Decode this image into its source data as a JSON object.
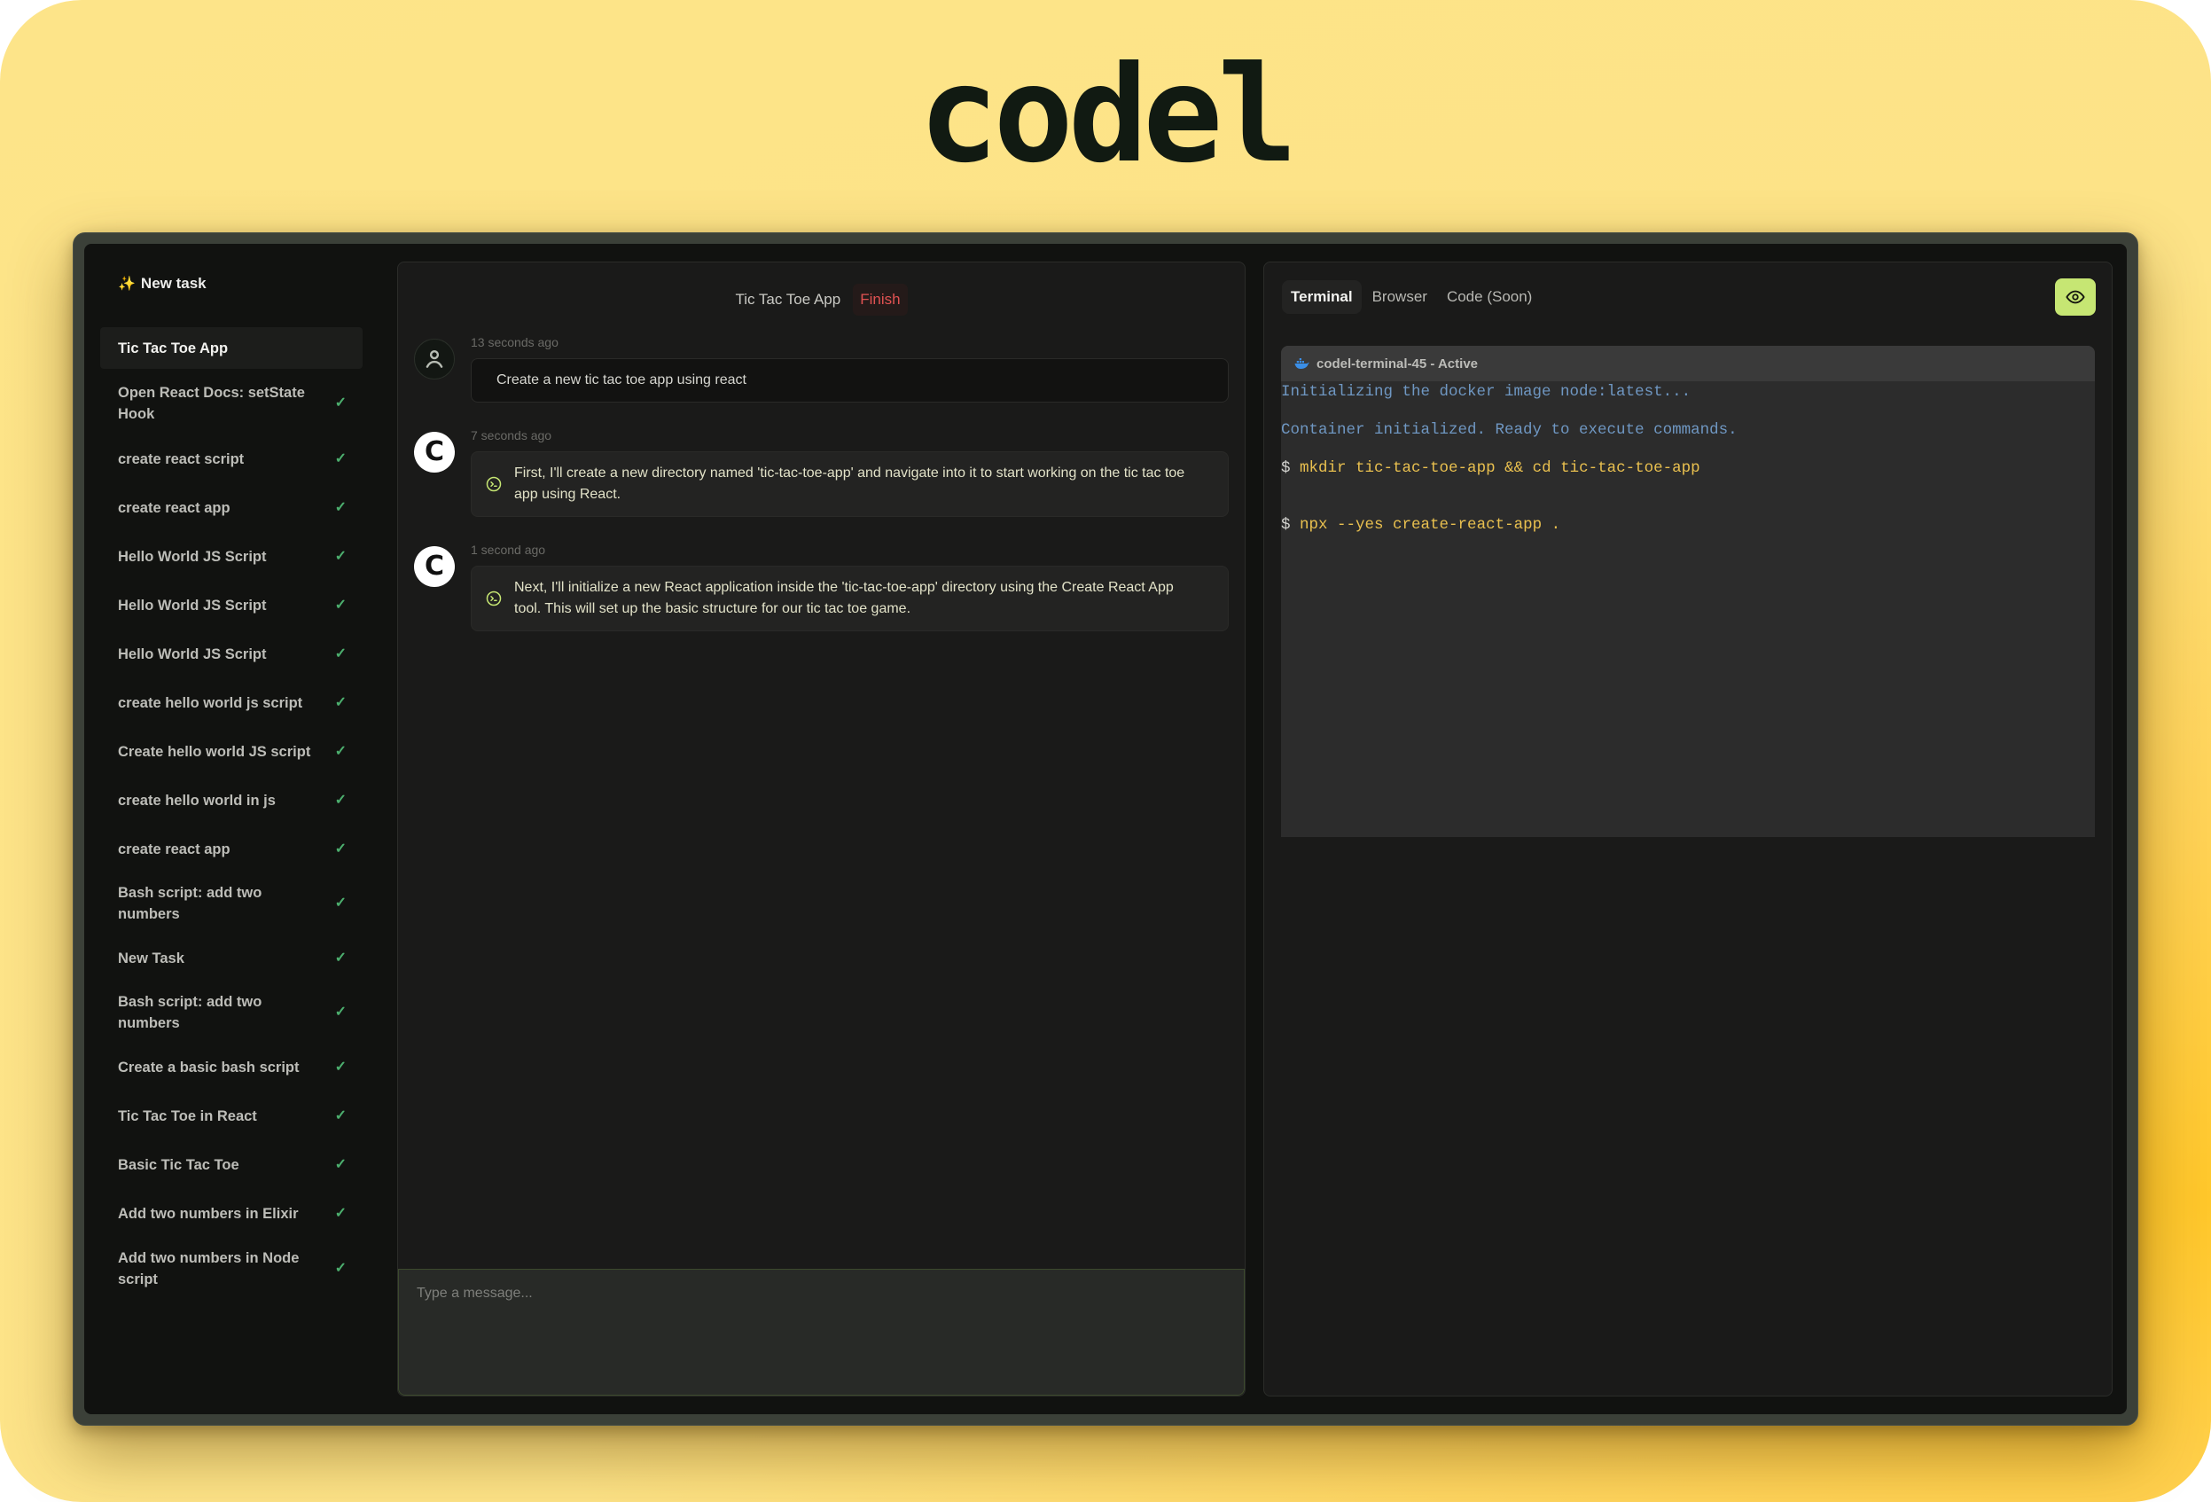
{
  "brand": {
    "logo_text": "codel"
  },
  "sidebar": {
    "new_task_icon": "sparkles-icon",
    "new_task_label": "New task",
    "tasks": [
      {
        "label": "Tic Tac Toe App",
        "active": true,
        "done": false
      },
      {
        "label": "Open React Docs: setState Hook",
        "done": true
      },
      {
        "label": "create react script",
        "done": true
      },
      {
        "label": "create react app",
        "done": true
      },
      {
        "label": "Hello World JS Script",
        "done": true
      },
      {
        "label": "Hello World JS Script",
        "done": true
      },
      {
        "label": "Hello World JS Script",
        "done": true
      },
      {
        "label": "create hello world js script",
        "done": true
      },
      {
        "label": "Create hello world JS script",
        "done": true
      },
      {
        "label": "create hello world in js",
        "done": true
      },
      {
        "label": "create react app",
        "done": true
      },
      {
        "label": "Bash script: add two numbers",
        "done": true
      },
      {
        "label": "New Task",
        "done": true
      },
      {
        "label": "Bash script: add two numbers",
        "done": true
      },
      {
        "label": "Create a basic bash script",
        "done": true
      },
      {
        "label": "Tic Tac Toe in React",
        "done": true
      },
      {
        "label": "Basic Tic Tac Toe",
        "done": true
      },
      {
        "label": "Add two numbers in Elixir",
        "done": true
      },
      {
        "label": "Add two numbers in Node script",
        "done": true
      }
    ],
    "check_glyph": "✓"
  },
  "chat": {
    "title": "Tic Tac Toe App",
    "finish_label": "Finish",
    "messages": [
      {
        "role": "user",
        "avatar_icon": "user-icon",
        "timestamp": "13 seconds ago",
        "text": "Create a new tic tac toe app using react"
      },
      {
        "role": "assistant",
        "avatar_letter": "C",
        "icon": "terminal-icon",
        "timestamp": "7 seconds ago",
        "text": "First, I'll create a new directory named 'tic-tac-toe-app' and navigate into it to start working on the tic tac toe app using React."
      },
      {
        "role": "assistant",
        "avatar_letter": "C",
        "icon": "terminal-icon",
        "timestamp": "1 second ago",
        "text": "Next, I'll initialize a new React application inside the 'tic-tac-toe-app' directory using the Create React App tool. This will set up the basic structure for our tic tac toe game."
      }
    ],
    "input": {
      "value": "",
      "placeholder": "Type a message..."
    }
  },
  "right_panel": {
    "tabs": [
      {
        "label": "Terminal",
        "active": true
      },
      {
        "label": "Browser",
        "active": false
      },
      {
        "label": "Code (Soon)",
        "active": false
      }
    ],
    "eye_button_icon": "eye-icon",
    "terminal": {
      "header_icon": "docker-icon",
      "header": "codel-terminal-45 - Active",
      "lines": [
        {
          "type": "info",
          "text": "Initializing the docker image node:latest..."
        },
        {
          "type": "info",
          "text": "Container initialized. Ready to execute commands."
        },
        {
          "type": "cmd",
          "prompt": "$",
          "text": "mkdir tic-tac-toe-app && cd tic-tac-toe-app"
        },
        {
          "type": "cmd",
          "prompt": "$",
          "text": "npx --yes create-react-app ."
        }
      ]
    }
  },
  "colors": {
    "accent_green": "#c6e673",
    "finish_red": "#e05252",
    "check_green": "#4caf6e",
    "terminal_info": "#6f97c2",
    "terminal_cmd": "#e9c04f",
    "background_yellow": "#fde489"
  }
}
